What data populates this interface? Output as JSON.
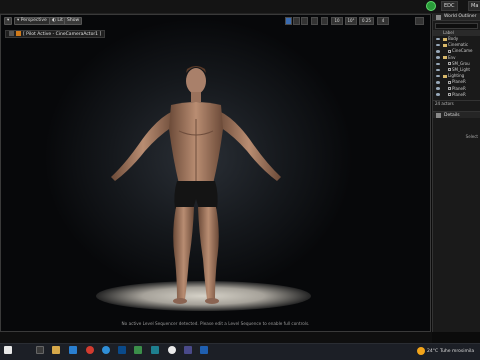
{
  "toolbar_top": {
    "btn_a": "EDC",
    "btn_b": "Ma"
  },
  "viewport": {
    "perspective_label": "Perspective",
    "lit_label": "Lit",
    "show_label": "Show",
    "pilot_label": "[ Pilot Active - CineCameraActor1 ]",
    "right_buttons": [
      "10",
      "10°",
      "0.25",
      "4"
    ],
    "notice": "No active Level Sequencer detected. Please edit a Level Sequence to enable full controls."
  },
  "world_outliner": {
    "title": "World Outliner",
    "column_label": "Label",
    "items": [
      "Body",
      "Cinematic",
      "CineCame",
      "Env",
      "SM_Grou",
      "SM_Light",
      "Lighting",
      "PlaneR",
      "PlaneR",
      "PlaneR"
    ],
    "actor_count": "24 actors",
    "details_title": "Details",
    "select_hint": "Select"
  },
  "taskbar": {
    "temperature": "24°C",
    "weather": "Tuhe mrosimila"
  }
}
